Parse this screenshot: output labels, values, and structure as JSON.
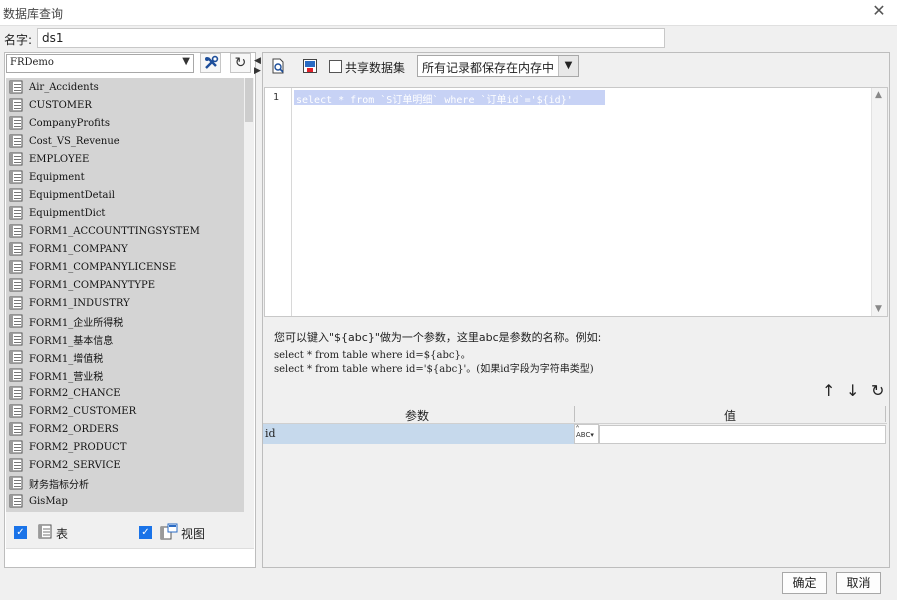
{
  "window": {
    "title": "数据库查询"
  },
  "name": {
    "label": "名字:",
    "value": "ds1"
  },
  "left": {
    "database": "FRDemo",
    "tables": [
      "Air_Accidents",
      "CUSTOMER",
      "CompanyProfits",
      "Cost_VS_Revenue",
      "EMPLOYEE",
      "Equipment",
      "EquipmentDetail",
      "EquipmentDict",
      "FORM1_ACCOUNTTINGSYSTEM",
      "FORM1_COMPANY",
      "FORM1_COMPANYLICENSE",
      "FORM1_COMPANYTYPE",
      "FORM1_INDUSTRY",
      "FORM1_企业所得税",
      "FORM1_基本信息",
      "FORM1_增值税",
      "FORM1_营业税",
      "FORM2_CHANCE",
      "FORM2_CUSTOMER",
      "FORM2_ORDERS",
      "FORM2_PRODUCT",
      "FORM2_SERVICE",
      "财务指标分析",
      "GisMap"
    ],
    "filter_table_label": "表",
    "filter_view_label": "视图"
  },
  "toolbar": {
    "share_dataset_label": "共享数据集",
    "memory_mode": "所有记录都保存在内存中"
  },
  "editor": {
    "line_number": "1",
    "sql": "select * from `S订单明细` where `订单id`='${id}'"
  },
  "hints": {
    "line1": "您可以键入\"${abc}\"做为一个参数，这里abc是参数的名称。例如:",
    "line2": "select * from table where id=${abc}。",
    "line3": "select * from table where id='${abc}'。(如果id字段为字符串类型)"
  },
  "params": {
    "col_param": "参数",
    "col_value": "值",
    "rows": [
      {
        "name": "id",
        "value": ""
      }
    ]
  },
  "footer": {
    "ok_label": "确定",
    "cancel_label": "取消"
  }
}
